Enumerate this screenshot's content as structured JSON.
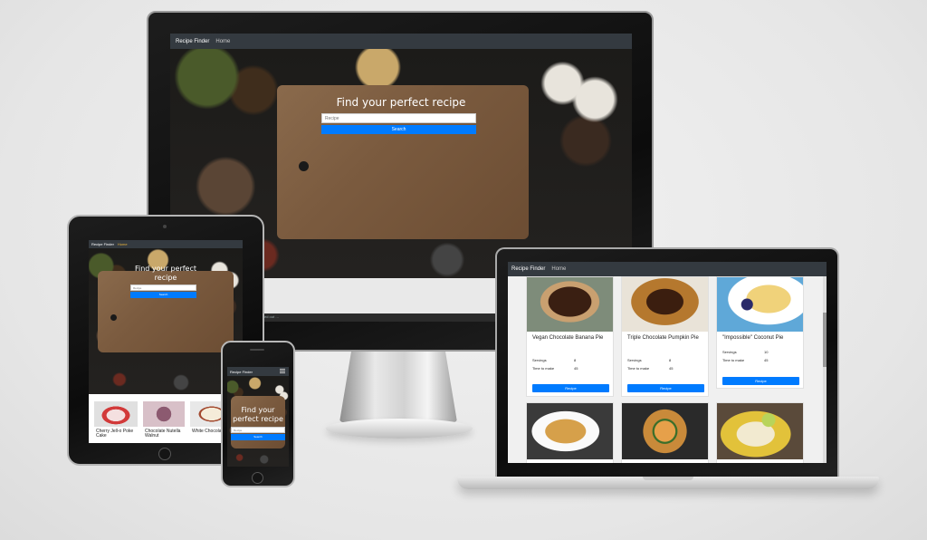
{
  "site": {
    "brand": "Recipe Finder",
    "nav_home": "Home",
    "hero_title": "Find your perfect recipe",
    "search_placeholder": "Recipe",
    "search_button": "Search",
    "recipe_button": "Recipe"
  },
  "monitor": {
    "status_text": "…ed out …"
  },
  "laptop": {
    "cards": [
      {
        "title": "Vegan Chocolate Banana Pie",
        "servings_label": "Servings",
        "servings": "8",
        "time_label": "Time to make",
        "time": "45",
        "image": "chocolate-pie"
      },
      {
        "title": "Triple Chocolate Pumpkin Pie",
        "servings_label": "Servings",
        "servings": "8",
        "time_label": "Time to make",
        "time": "45",
        "image": "pumpkin-pie"
      },
      {
        "title": "\"Impossible\" Coconut Pie",
        "servings_label": "Servings",
        "servings": "10",
        "time_label": "Time to make",
        "time": "45",
        "image": "coconut-pie"
      }
    ],
    "bottom_cards": [
      {
        "image": "lasagna"
      },
      {
        "image": "pizza"
      },
      {
        "image": "lemon-pie"
      }
    ]
  },
  "tablet": {
    "cards": [
      {
        "title": "Cherry Jell-o Poke Cake",
        "image": "cherry-cake"
      },
      {
        "title": "Chocolate Nutella Walnut",
        "image": "nutella"
      },
      {
        "title": "White Chocolate",
        "image": "white-chocolate"
      }
    ]
  },
  "colors": {
    "navbar": "#343a40",
    "primary": "#007bff",
    "device_body": "#111111"
  }
}
